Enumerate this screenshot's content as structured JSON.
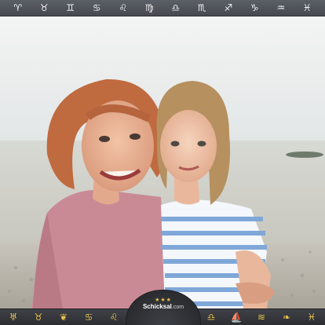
{
  "zodiac_bar": {
    "signs": [
      {
        "name": "aries",
        "glyph": "♈"
      },
      {
        "name": "taurus",
        "glyph": "♉"
      },
      {
        "name": "gemini",
        "glyph": "♊"
      },
      {
        "name": "cancer",
        "glyph": "♋"
      },
      {
        "name": "leo",
        "glyph": "♌"
      },
      {
        "name": "virgo",
        "glyph": "♍"
      },
      {
        "name": "libra",
        "glyph": "♎"
      },
      {
        "name": "scorpio",
        "glyph": "♏"
      },
      {
        "name": "sagittarius",
        "glyph": "♐"
      },
      {
        "name": "capricorn",
        "glyph": "♑"
      },
      {
        "name": "aquarius",
        "glyph": "♒"
      },
      {
        "name": "pisces",
        "glyph": "♓"
      }
    ]
  },
  "bottom_bar": {
    "left_icons": [
      {
        "name": "fox-icon",
        "glyph": "♅"
      },
      {
        "name": "bull-icon",
        "glyph": "♉"
      },
      {
        "name": "butterfly-icon",
        "glyph": "❦"
      },
      {
        "name": "crab-icon",
        "glyph": "♋"
      },
      {
        "name": "tiger-icon",
        "glyph": "♌"
      },
      {
        "name": "mask-icon",
        "glyph": "✺"
      }
    ],
    "right_icons": [
      {
        "name": "shield-icon",
        "glyph": "◈"
      },
      {
        "name": "scales-icon",
        "glyph": "♎"
      },
      {
        "name": "ship-icon",
        "glyph": "⛵"
      },
      {
        "name": "wave-icon",
        "glyph": "≋"
      },
      {
        "name": "feather-icon",
        "glyph": "❧"
      },
      {
        "name": "fish-icon",
        "glyph": "♓"
      }
    ],
    "logo": {
      "stars": "★★★",
      "brand": "Schicksal",
      "domain": ".com"
    }
  },
  "colors": {
    "bar": "#4d5056",
    "icon_gold": "#e8c24a",
    "sky": "#e9eceb",
    "sea": "#c9cbc4",
    "pebbles": "#b9b4ab"
  }
}
